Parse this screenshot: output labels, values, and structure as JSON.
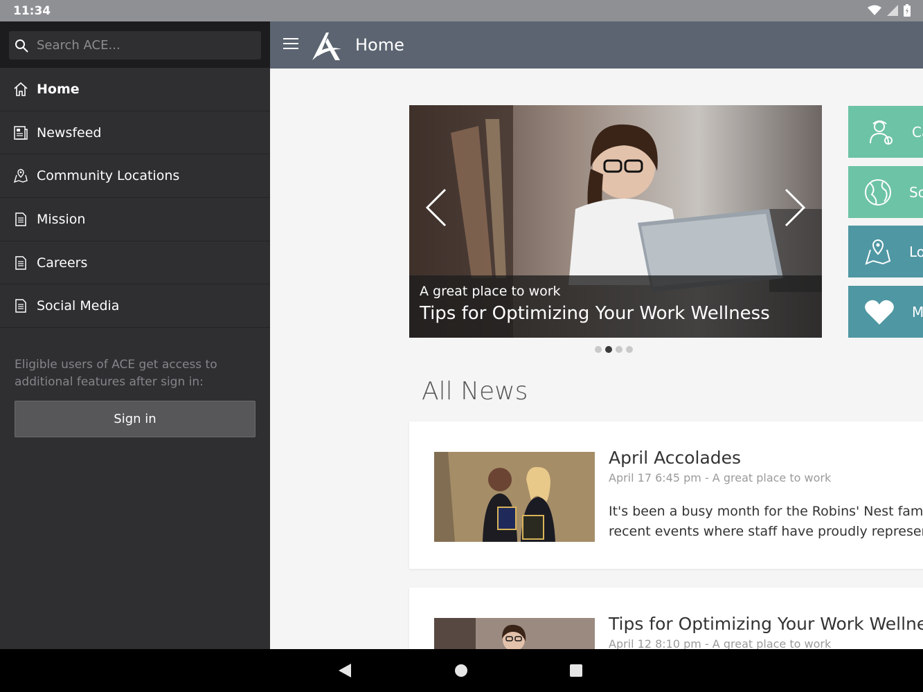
{
  "status": {
    "time": "11:34"
  },
  "sidebar": {
    "search_placeholder": "Search ACE...",
    "items": [
      {
        "label": "Home",
        "icon": "home-icon"
      },
      {
        "label": "Newsfeed",
        "icon": "newsfeed-icon"
      },
      {
        "label": "Community Locations",
        "icon": "location-map-icon"
      },
      {
        "label": "Mission",
        "icon": "document-icon"
      },
      {
        "label": "Careers",
        "icon": "document-icon"
      },
      {
        "label": "Social Media",
        "icon": "document-icon"
      }
    ],
    "note": "Eligible users of ACE get access to additional features after sign in:",
    "signin_label": "Sign in"
  },
  "header": {
    "title": "Home"
  },
  "carousel": {
    "subtitle": "A great place to work",
    "headline": "Tips for Optimizing Your Work Wellness",
    "slide_count": 4,
    "active_slide": 1
  },
  "tiles": [
    {
      "label": "Ca",
      "icon": "caregiver-icon",
      "color": "#6dc3a5"
    },
    {
      "label": "So",
      "icon": "globe-icon",
      "color": "#6dc3a5"
    },
    {
      "label": "Lo",
      "icon": "location-map-icon",
      "color": "#4f97a3"
    },
    {
      "label": "M",
      "icon": "heart-icon",
      "color": "#4f97a3"
    }
  ],
  "news": {
    "section_title": "All News",
    "items": [
      {
        "title": "April Accolades",
        "meta": "April 17 6:45 pm - A great place to work",
        "body_line1": "It's been a busy month for the Robins' Nest family",
        "body_line2": "recent events where staff have proudly represente"
      },
      {
        "title": "Tips for Optimizing Your Work Wellnes",
        "meta": "April 12 8:10 pm - A great place to work"
      }
    ]
  },
  "colors": {
    "sidebar_bg": "#2f2f31",
    "header_bg": "#5b6470",
    "teal": "#6dc3a5",
    "blue_teal": "#4f97a3"
  }
}
